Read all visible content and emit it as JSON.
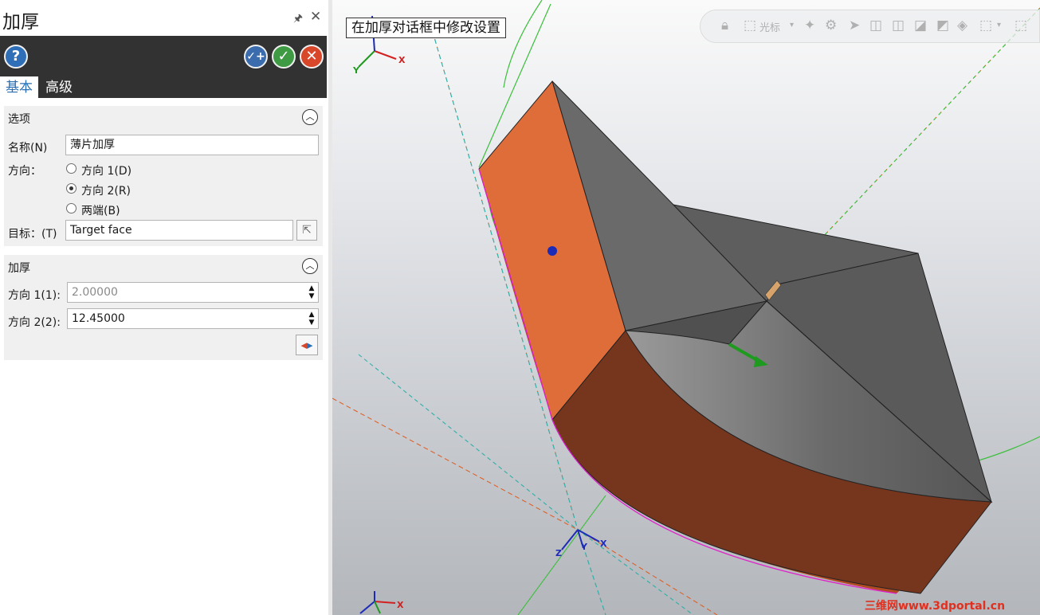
{
  "panel": {
    "title": "加厚",
    "pin_icon": "pin-icon",
    "close_icon": "close-icon",
    "tabs": [
      {
        "label": "基本",
        "active": true
      },
      {
        "label": "高级",
        "active": false
      }
    ],
    "toolbar": {
      "help_icon": "?",
      "ok_continue_icon": "✓+",
      "ok_icon": "✓",
      "cancel_icon": "✕"
    },
    "options": {
      "title": "选项",
      "name_label": "名称(N)",
      "name_value": "薄片加厚",
      "direction_label": "方向：",
      "radios": [
        {
          "label": "方向 1(D)",
          "checked": false
        },
        {
          "label": "方向 2(R)",
          "checked": true
        },
        {
          "label": "两端(B)",
          "checked": false
        }
      ],
      "target_label": "目标：(T)",
      "target_value": "Target face"
    },
    "thicken": {
      "title": "加厚",
      "dir1_label": "方向 1(1):",
      "dir1_value": "2.00000",
      "dir2_label": "方向 2(2):",
      "dir2_value": "12.45000"
    }
  },
  "viewport": {
    "tooltip": "在加厚对话框中修改设置",
    "view_toolbar": {
      "cursor_label": "光标"
    },
    "axes": {
      "x": "X",
      "y": "Y",
      "z": "Z"
    },
    "watermark": "三维网www.3dportal.cn"
  },
  "colors": {
    "orange_face": "#de6d3a",
    "brown_face": "#76361e",
    "grey_face": "#646464",
    "accent_blue": "#2a6fb5"
  }
}
